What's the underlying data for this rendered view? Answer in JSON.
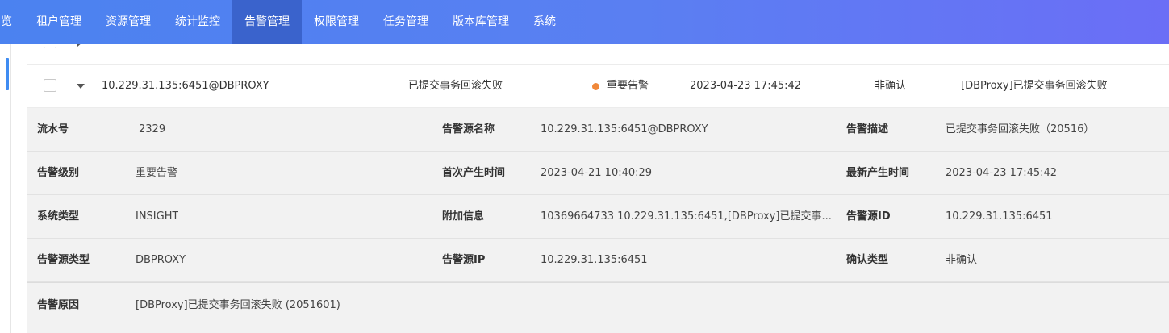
{
  "nav": {
    "items": [
      {
        "label": "览"
      },
      {
        "label": "租户管理"
      },
      {
        "label": "资源管理"
      },
      {
        "label": "统计监控"
      },
      {
        "label": "告警管理"
      },
      {
        "label": "权限管理"
      },
      {
        "label": "任务管理"
      },
      {
        "label": "版本库管理"
      },
      {
        "label": "系统"
      }
    ],
    "active_index": 4
  },
  "colors": {
    "nav_gradient_start": "#4b82f0",
    "nav_gradient_end": "#6b6ef6",
    "nav_active": "#3a63cc",
    "important_dot": "#f0883a",
    "detail_bg": "#f2f2f2",
    "accent": "#3f8cf2"
  },
  "table": {
    "rows": [
      {
        "source": "10.229.31.135:6451@DBPROXY",
        "name": "已提交事务回滚失败",
        "level": "重要告警",
        "time": "2023-04-23 17:45:42",
        "confirm": "非确认",
        "description": "[DBProxy]已提交事务回滚失败",
        "expanded": true
      }
    ]
  },
  "detail": {
    "serial": {
      "label": "流水号",
      "value": "2329"
    },
    "source_name": {
      "label": "告警源名称",
      "value": "10.229.31.135:6451@DBPROXY"
    },
    "alarm_desc": {
      "label": "告警描述",
      "value": "已提交事务回滚失败（20516）"
    },
    "alarm_level": {
      "label": "告警级别",
      "value": "重要告警"
    },
    "first_time": {
      "label": "首次产生时间",
      "value": "2023-04-21 10:40:29"
    },
    "latest_time": {
      "label": "最新产生时间",
      "value": "2023-04-23 17:45:42"
    },
    "system_type": {
      "label": "系统类型",
      "value": "INSIGHT"
    },
    "extra_info": {
      "label": "附加信息",
      "value": "10369664733 10.229.31.135:6451,[DBProxy]已提交事..."
    },
    "source_id": {
      "label": "告警源ID",
      "value": "10.229.31.135:6451"
    },
    "source_type": {
      "label": "告警源类型",
      "value": "DBPROXY"
    },
    "source_ip": {
      "label": "告警源IP",
      "value": "10.229.31.135:6451"
    },
    "confirm_type": {
      "label": "确认类型",
      "value": "非确认"
    },
    "reason": {
      "label": "告警原因",
      "value": "[DBProxy]已提交事务回滚失败 (2051601)"
    }
  }
}
